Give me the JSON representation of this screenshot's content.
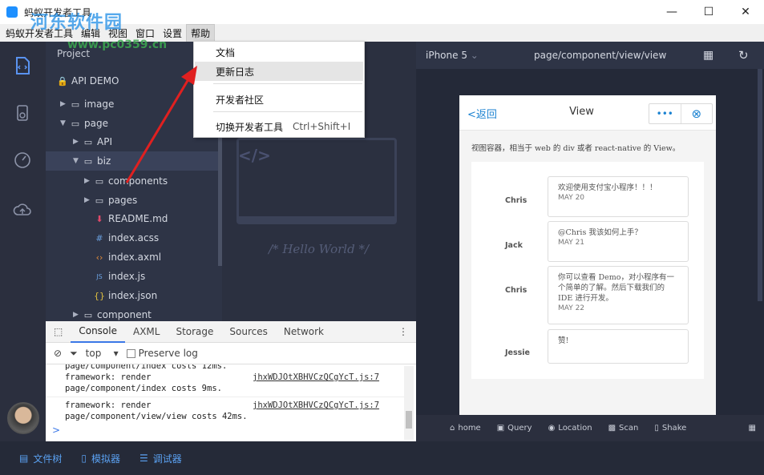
{
  "window": {
    "title": "蚂蚁开发者工具",
    "controls": [
      "—",
      "☐",
      "✕"
    ]
  },
  "menubar": {
    "items": [
      "蚂蚁开发者工具",
      "编辑",
      "视图",
      "窗口",
      "设置",
      "帮助"
    ],
    "active": "帮助"
  },
  "help_menu": {
    "items": [
      {
        "label": "文档",
        "shortcut": ""
      },
      {
        "label": "更新日志",
        "shortcut": ""
      },
      {
        "label": "开发者社区",
        "shortcut": ""
      },
      {
        "label": "切换开发者工具",
        "shortcut": "Ctrl+Shift+I"
      }
    ]
  },
  "project": {
    "header": "Project",
    "root": "API DEMO",
    "tree": [
      {
        "label": "image",
        "type": "folder",
        "depth": 0,
        "expanded": false
      },
      {
        "label": "page",
        "type": "folder",
        "depth": 0,
        "expanded": true
      },
      {
        "label": "API",
        "type": "folder",
        "depth": 1,
        "expanded": false
      },
      {
        "label": "biz",
        "type": "folder",
        "depth": 1,
        "expanded": true,
        "selected": true
      },
      {
        "label": "components",
        "type": "folder",
        "depth": 2,
        "expanded": false
      },
      {
        "label": "pages",
        "type": "folder",
        "depth": 2,
        "expanded": false
      },
      {
        "label": "README.md",
        "type": "md",
        "depth": 2
      },
      {
        "label": "index.acss",
        "type": "acss",
        "depth": 2
      },
      {
        "label": "index.axml",
        "type": "axml",
        "depth": 2
      },
      {
        "label": "index.js",
        "type": "js",
        "depth": 2
      },
      {
        "label": "index.json",
        "type": "json",
        "depth": 2
      },
      {
        "label": "component",
        "type": "folder",
        "depth": 1,
        "expanded": false
      }
    ]
  },
  "editor": {
    "code_glyph": "</>",
    "placeholder": "/* Hello World */"
  },
  "devtools": {
    "tabs": [
      "Console",
      "AXML",
      "Storage",
      "Sources",
      "Network"
    ],
    "active_tab": "Console",
    "filter": "top",
    "preserve_log": "Preserve log",
    "logs": [
      {
        "text": "page/component/index costs 12ms.",
        "link": ""
      },
      {
        "text": "framework: render",
        "link": "jhxWDJOtXBHVCzQCgYcT.js:7"
      },
      {
        "text": "page/component/index costs 9ms.",
        "link": ""
      },
      {
        "text": "framework: render",
        "link": "jhxWDJOtXBHVCzQCgYcT.js:7"
      },
      {
        "text": "page/component/view/view costs 42ms.",
        "link": ""
      }
    ],
    "prompt": ">"
  },
  "simulator": {
    "device": "iPhone 5",
    "path": "page/component/view/view",
    "nav_back": "<返回",
    "nav_title": "View",
    "capsule_more": "•••",
    "capsule_close": "⊗",
    "description": "视图容器，相当于 web 的 div 或者 react-native 的 View。",
    "messages": [
      {
        "name": "Chris",
        "text": "欢迎使用支付宝小程序！！！",
        "date": "MAY 20"
      },
      {
        "name": "Jack",
        "text": "@Chris 我该如何上手？",
        "date": "MAY 21"
      },
      {
        "name": "Chris",
        "text": "你可以查看 Demo，对小程序有一个简单的了解。然后下载我们的 IDE 进行开发。",
        "date": "MAY 22"
      },
      {
        "name": "Jessie",
        "text": "赞!",
        "date": ""
      }
    ],
    "toolbar": [
      "home",
      "Query",
      "Location",
      "Scan",
      "Shake"
    ]
  },
  "statusbar": {
    "items": [
      "文件树",
      "模拟器",
      "调试器"
    ]
  },
  "watermark": {
    "title": "河东软件园",
    "url": "www.pc0359.cn"
  },
  "colors": {
    "accent": "#5a93f0",
    "arrow": "#e02020",
    "link": "#1b82d1"
  }
}
